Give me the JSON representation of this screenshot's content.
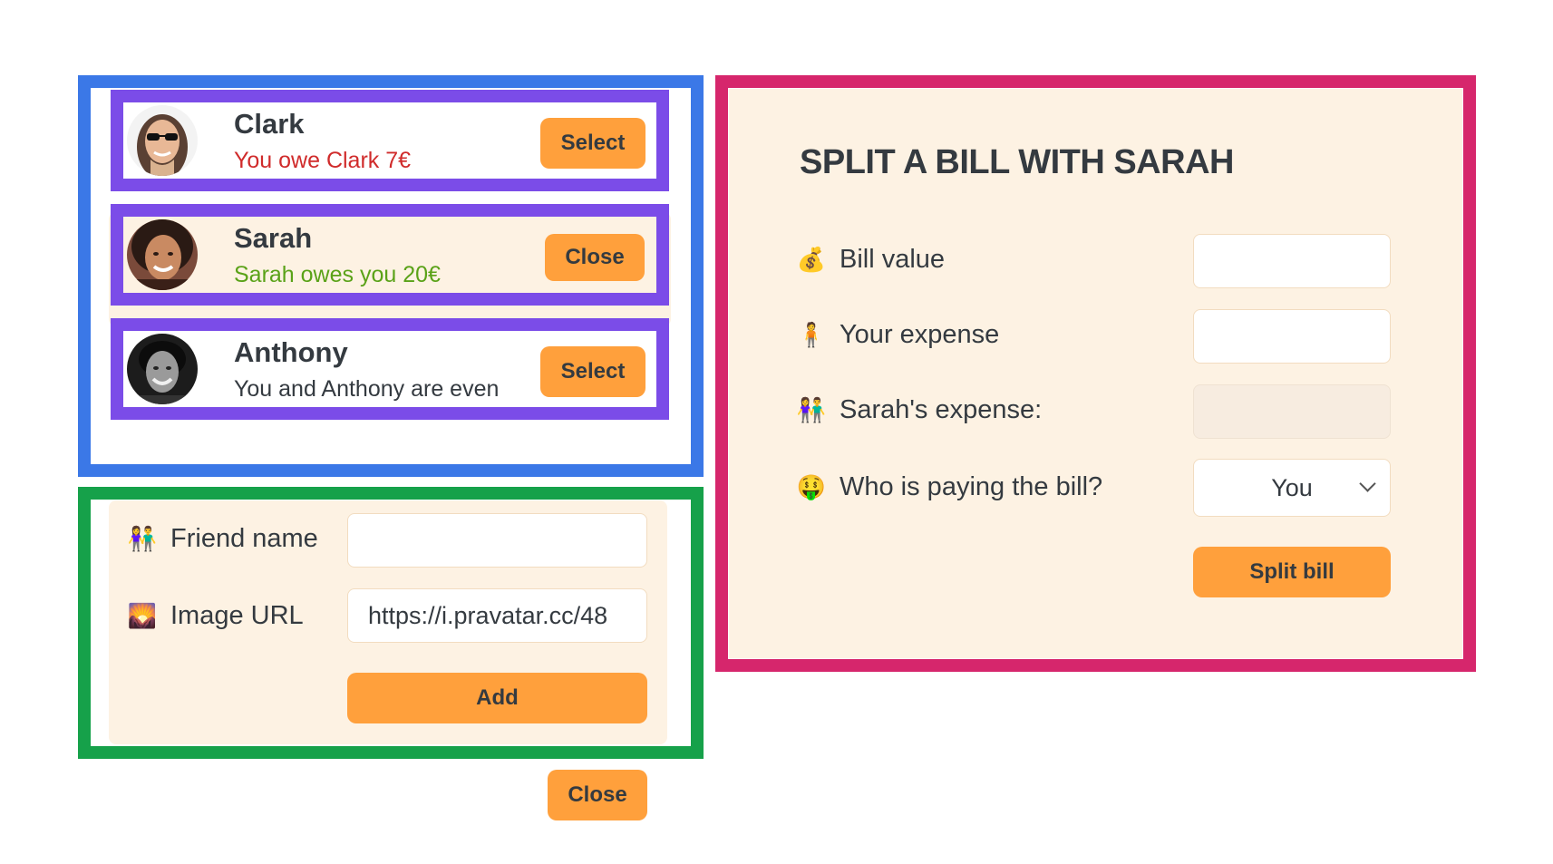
{
  "friends": [
    {
      "name": "Clark",
      "balance": "You owe Clark 7€",
      "button": "Select"
    },
    {
      "name": "Sarah",
      "balance": "Sarah owes you 20€",
      "button": "Close"
    },
    {
      "name": "Anthony",
      "balance": "You and Anthony are even",
      "button": "Select"
    }
  ],
  "add_form": {
    "friend_name_icon": "👫",
    "friend_name_label": "Friend name",
    "friend_name_value": "",
    "image_url_icon": "🌄",
    "image_url_label": "Image URL",
    "image_url_value": "https://i.pravatar.cc/48",
    "add_label": "Add"
  },
  "close_button_label": "Close",
  "split_form": {
    "title": "SPLIT A BILL WITH SARAH",
    "bill_icon": "💰",
    "bill_label": "Bill value",
    "bill_value": "",
    "expense_icon": "🧍",
    "expense_label": "Your expense",
    "expense_value": "",
    "friend_expense_icon": "👫",
    "friend_expense_label": "Sarah's expense:",
    "friend_expense_value": "",
    "payer_icon": "🤑",
    "payer_label": "Who is paying the bill?",
    "payer_selected": "You",
    "split_label": "Split bill"
  },
  "colors": {
    "accent": "#ffa03c",
    "panel_bg": "#fdf2e3",
    "owe_red": "#d02b2b",
    "owed_green": "#5aa218",
    "outline_blue": "#3b78e7",
    "outline_purple": "#7b4ce8",
    "outline_green": "#16a14a",
    "outline_pink": "#d6266c"
  }
}
